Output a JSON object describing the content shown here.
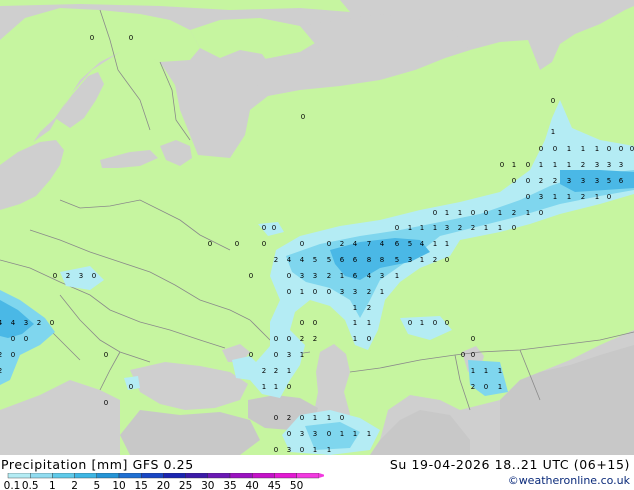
{
  "footer": {
    "title": "Precipitation [mm]  GFS 0.25",
    "valid_time": "Su 19-04-2026 18..21 UTC (06+15)",
    "copyright": "©weatheronline.co.uk"
  },
  "scale": {
    "labels": [
      "0.1",
      "0.5",
      "1",
      "2",
      "5",
      "10",
      "15",
      "20",
      "25",
      "30",
      "35",
      "40",
      "45",
      "50"
    ],
    "colors": [
      "#b4ecf4",
      "#91dcf0",
      "#5fcaea",
      "#3eb6e4",
      "#2494d6",
      "#1f6fd2",
      "#1846c4",
      "#1a24b0",
      "#3b1aa8",
      "#6a18b4",
      "#9a12c0",
      "#c412c8",
      "#e21ad2",
      "#f23ae0"
    ]
  },
  "colors": {
    "land": "#c6f5a0",
    "water": "#cfcfcf",
    "border": "#8a8a8a",
    "rain_light": "#b4ecf4",
    "rain_medium": "#7fd6ee",
    "rain_heavy": "#4ab8e6"
  },
  "map_values": [
    [
      "0",
      92,
      38
    ],
    [
      "0",
      131,
      38
    ],
    [
      "0",
      303,
      117
    ],
    [
      "0",
      553,
      101
    ],
    [
      "1",
      553,
      132
    ],
    [
      "0",
      541,
      149
    ],
    [
      "0",
      555,
      149
    ],
    [
      "1",
      569,
      149
    ],
    [
      "1",
      583,
      149
    ],
    [
      "1",
      597,
      149
    ],
    [
      "0",
      609,
      149
    ],
    [
      "0",
      621,
      149
    ],
    [
      "0",
      632,
      149
    ],
    [
      "0",
      502,
      165
    ],
    [
      "1",
      514,
      165
    ],
    [
      "0",
      528,
      165
    ],
    [
      "1",
      541,
      165
    ],
    [
      "1",
      555,
      165
    ],
    [
      "1",
      569,
      165
    ],
    [
      "2",
      583,
      165
    ],
    [
      "3",
      597,
      165
    ],
    [
      "3",
      609,
      165
    ],
    [
      "3",
      621,
      165
    ],
    [
      "0",
      514,
      181
    ],
    [
      "0",
      528,
      181
    ],
    [
      "2",
      541,
      181
    ],
    [
      "2",
      555,
      181
    ],
    [
      "3",
      569,
      181
    ],
    [
      "3",
      583,
      181
    ],
    [
      "3",
      597,
      181
    ],
    [
      "5",
      609,
      181
    ],
    [
      "6",
      621,
      181
    ],
    [
      "0",
      528,
      197
    ],
    [
      "3",
      541,
      197
    ],
    [
      "1",
      555,
      197
    ],
    [
      "1",
      569,
      197
    ],
    [
      "2",
      583,
      197
    ],
    [
      "1",
      597,
      197
    ],
    [
      "0",
      609,
      197
    ],
    [
      "0",
      435,
      213
    ],
    [
      "1",
      447,
      213
    ],
    [
      "1",
      460,
      213
    ],
    [
      "0",
      473,
      213
    ],
    [
      "0",
      486,
      213
    ],
    [
      "1",
      500,
      213
    ],
    [
      "2",
      514,
      213
    ],
    [
      "1",
      528,
      213
    ],
    [
      "0",
      541,
      213
    ],
    [
      "0",
      264,
      228
    ],
    [
      "0",
      274,
      228
    ],
    [
      "0",
      397,
      228
    ],
    [
      "1",
      410,
      228
    ],
    [
      "1",
      422,
      228
    ],
    [
      "1",
      435,
      228
    ],
    [
      "3",
      447,
      228
    ],
    [
      "2",
      460,
      228
    ],
    [
      "2",
      473,
      228
    ],
    [
      "1",
      486,
      228
    ],
    [
      "1",
      500,
      228
    ],
    [
      "0",
      514,
      228
    ],
    [
      "0",
      210,
      244
    ],
    [
      "0",
      237,
      244
    ],
    [
      "0",
      264,
      244
    ],
    [
      "0",
      302,
      244
    ],
    [
      "0",
      329,
      244
    ],
    [
      "2",
      342,
      244
    ],
    [
      "4",
      355,
      244
    ],
    [
      "7",
      369,
      244
    ],
    [
      "4",
      382,
      244
    ],
    [
      "6",
      397,
      244
    ],
    [
      "5",
      410,
      244
    ],
    [
      "4",
      422,
      244
    ],
    [
      "1",
      435,
      244
    ],
    [
      "1",
      447,
      244
    ],
    [
      "2",
      276,
      260
    ],
    [
      "4",
      289,
      260
    ],
    [
      "4",
      302,
      260
    ],
    [
      "5",
      315,
      260
    ],
    [
      "5",
      329,
      260
    ],
    [
      "6",
      342,
      260
    ],
    [
      "6",
      355,
      260
    ],
    [
      "8",
      369,
      260
    ],
    [
      "8",
      382,
      260
    ],
    [
      "5",
      397,
      260
    ],
    [
      "3",
      410,
      260
    ],
    [
      "1",
      422,
      260
    ],
    [
      "2",
      435,
      260
    ],
    [
      "0",
      447,
      260
    ],
    [
      "0",
      251,
      276
    ],
    [
      "0",
      289,
      276
    ],
    [
      "3",
      302,
      276
    ],
    [
      "3",
      315,
      276
    ],
    [
      "2",
      329,
      276
    ],
    [
      "1",
      342,
      276
    ],
    [
      "6",
      355,
      276
    ],
    [
      "4",
      369,
      276
    ],
    [
      "3",
      382,
      276
    ],
    [
      "1",
      397,
      276
    ],
    [
      "0",
      289,
      292
    ],
    [
      "1",
      302,
      292
    ],
    [
      "0",
      315,
      292
    ],
    [
      "0",
      329,
      292
    ],
    [
      "3",
      342,
      292
    ],
    [
      "3",
      355,
      292
    ],
    [
      "2",
      369,
      292
    ],
    [
      "1",
      382,
      292
    ],
    [
      "1",
      355,
      308
    ],
    [
      "2",
      369,
      308
    ],
    [
      "0",
      302,
      323
    ],
    [
      "0",
      315,
      323
    ],
    [
      "1",
      355,
      323
    ],
    [
      "1",
      369,
      323
    ],
    [
      "0",
      410,
      323
    ],
    [
      "1",
      422,
      323
    ],
    [
      "0",
      435,
      323
    ],
    [
      "0",
      447,
      323
    ],
    [
      "0",
      276,
      339
    ],
    [
      "0",
      289,
      339
    ],
    [
      "2",
      302,
      339
    ],
    [
      "2",
      315,
      339
    ],
    [
      "1",
      355,
      339
    ],
    [
      "0",
      369,
      339
    ],
    [
      "0",
      473,
      339
    ],
    [
      "0",
      251,
      355
    ],
    [
      "0",
      276,
      355
    ],
    [
      "3",
      289,
      355
    ],
    [
      "1",
      302,
      355
    ],
    [
      "0",
      463,
      355
    ],
    [
      "0",
      473,
      355
    ],
    [
      "2",
      264,
      371
    ],
    [
      "2",
      276,
      371
    ],
    [
      "1",
      289,
      371
    ],
    [
      "1",
      473,
      371
    ],
    [
      "1",
      486,
      371
    ],
    [
      "1",
      500,
      371
    ],
    [
      "1",
      264,
      387
    ],
    [
      "1",
      276,
      387
    ],
    [
      "0",
      289,
      387
    ],
    [
      "2",
      473,
      387
    ],
    [
      "0",
      486,
      387
    ],
    [
      "1",
      500,
      387
    ],
    [
      "0",
      276,
      418
    ],
    [
      "2",
      289,
      418
    ],
    [
      "0",
      302,
      418
    ],
    [
      "1",
      315,
      418
    ],
    [
      "1",
      329,
      418
    ],
    [
      "0",
      342,
      418
    ],
    [
      "0",
      289,
      434
    ],
    [
      "3",
      302,
      434
    ],
    [
      "3",
      315,
      434
    ],
    [
      "0",
      329,
      434
    ],
    [
      "1",
      342,
      434
    ],
    [
      "1",
      355,
      434
    ],
    [
      "1",
      369,
      434
    ],
    [
      "0",
      276,
      450
    ],
    [
      "3",
      289,
      450
    ],
    [
      "0",
      302,
      450
    ],
    [
      "1",
      315,
      450
    ],
    [
      "1",
      329,
      450
    ],
    [
      "0",
      55,
      276
    ],
    [
      "2",
      68,
      276
    ],
    [
      "3",
      81,
      276
    ],
    [
      "0",
      94,
      276
    ],
    [
      "4",
      0,
      323
    ],
    [
      "4",
      13,
      323
    ],
    [
      "3",
      26,
      323
    ],
    [
      "2",
      39,
      323
    ],
    [
      "0",
      52,
      323
    ],
    [
      "0",
      13,
      339
    ],
    [
      "0",
      26,
      339
    ],
    [
      "2",
      0,
      355
    ],
    [
      "0",
      13,
      355
    ],
    [
      "2",
      0,
      371
    ],
    [
      "0",
      106,
      355
    ],
    [
      "0",
      131,
      387
    ],
    [
      "0",
      106,
      403
    ]
  ]
}
